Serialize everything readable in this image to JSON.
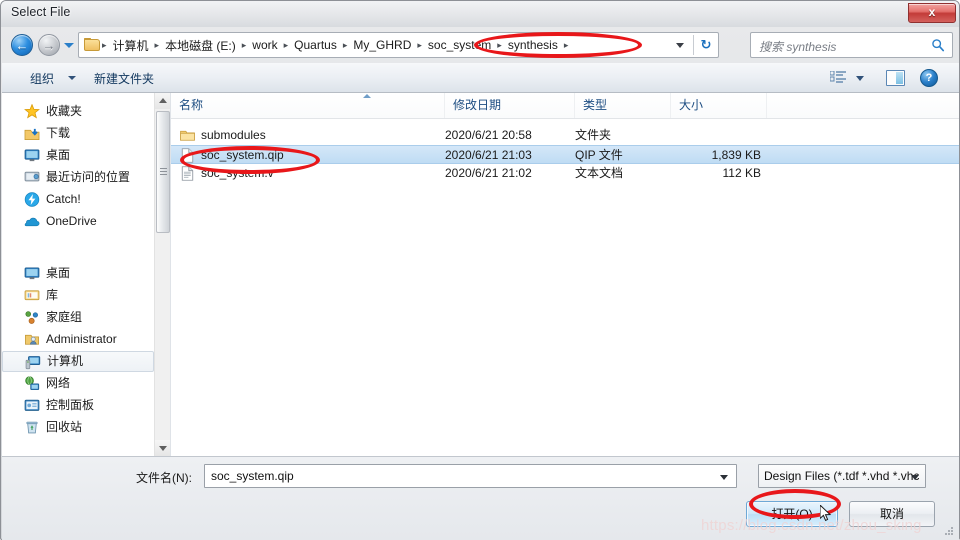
{
  "window": {
    "title": "Select File",
    "close_label": "x"
  },
  "nav": {
    "back_icon": "arrow-left-icon",
    "back_glyph": "←",
    "forward_icon": "arrow-right-icon",
    "forward_glyph": "→",
    "recent_dropdown_icon": "chevron-down-icon",
    "refresh_glyph": "↻",
    "breadcrumbs": [
      "计算机",
      "本地磁盘 (E:)",
      "work",
      "Quartus",
      "My_GHRD",
      "soc_system",
      "synthesis"
    ],
    "separator": "▸"
  },
  "search": {
    "placeholder": "搜索 synthesis",
    "icon": "search-icon"
  },
  "toolbar": {
    "organize_label": "组织",
    "new_folder_label": "新建文件夹",
    "view_icon": "list-view-icon",
    "preview_pane_icon": "preview-pane-icon",
    "help_icon": "help-icon",
    "help_glyph": "?"
  },
  "sidebar": {
    "groups": [
      {
        "root": "收藏夹",
        "root_icon": "star-icon",
        "items": [
          {
            "label": "下载",
            "icon": "downloads-icon"
          },
          {
            "label": "桌面",
            "icon": "desktop-icon"
          },
          {
            "label": "最近访问的位置",
            "icon": "recent-places-icon"
          },
          {
            "label": "Catch!",
            "icon": "catch-icon"
          },
          {
            "label": "OneDrive",
            "icon": "onedrive-icon"
          }
        ]
      },
      {
        "root": "桌面",
        "root_icon": "desktop-icon",
        "items": [
          {
            "label": "库",
            "icon": "library-icon"
          },
          {
            "label": "家庭组",
            "icon": "homegroup-icon"
          },
          {
            "label": "Administrator",
            "icon": "user-icon"
          },
          {
            "label": "计算机",
            "icon": "computer-icon",
            "selected": true
          },
          {
            "label": "网络",
            "icon": "network-icon"
          },
          {
            "label": "控制面板",
            "icon": "control-panel-icon"
          },
          {
            "label": "回收站",
            "icon": "recycle-bin-icon"
          }
        ]
      }
    ]
  },
  "filelist": {
    "columns": [
      {
        "label": "名称",
        "key": "name"
      },
      {
        "label": "修改日期",
        "key": "date"
      },
      {
        "label": "类型",
        "key": "type"
      },
      {
        "label": "大小",
        "key": "size"
      }
    ],
    "sort_indicator": "ascending",
    "rows": [
      {
        "name": "submodules",
        "date": "2020/6/21 20:58",
        "type": "文件夹",
        "size": "",
        "icon": "folder-icon",
        "selected": false
      },
      {
        "name": "soc_system.qip",
        "date": "2020/6/21 21:03",
        "type": "QIP 文件",
        "size": "1,839 KB",
        "icon": "file-icon",
        "selected": true
      },
      {
        "name": "soc_system.v",
        "date": "2020/6/21 21:02",
        "type": "文本文档",
        "size": "112 KB",
        "icon": "text-file-icon",
        "selected": false
      }
    ]
  },
  "footer": {
    "filename_label": "文件名(N):",
    "filename_value": "soc_system.qip",
    "filter_value": "Design Files (*.tdf *.vhd *.vhc",
    "open_label": "打开(O)",
    "cancel_label": "取消"
  },
  "annotations": {
    "color": "#e8171a",
    "watermark": "https://blog.csdn.net/zhou_sking"
  }
}
